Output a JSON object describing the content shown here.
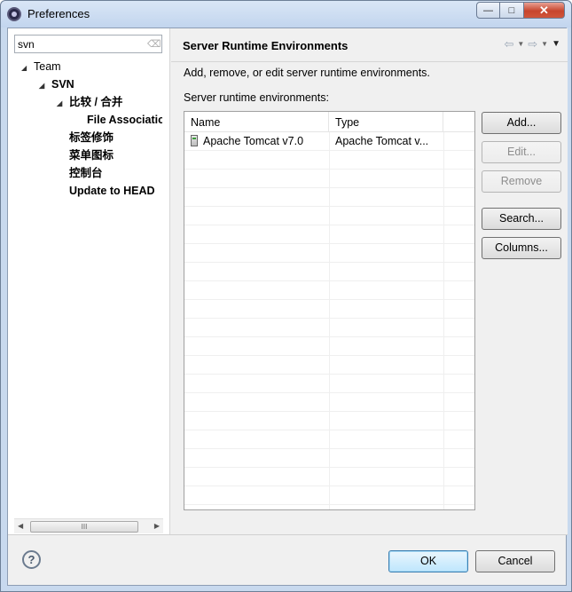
{
  "window": {
    "title": "Preferences",
    "min_glyph": "—",
    "max_glyph": "□",
    "close_glyph": "✕"
  },
  "sidebar": {
    "filter_value": "svn",
    "tree": [
      {
        "label": "Team",
        "twisty": "◢",
        "bold": false
      },
      {
        "label": "SVN",
        "twisty": "◢",
        "bold": true
      },
      {
        "label": "比较 / 合并",
        "twisty": "◢",
        "bold": true
      },
      {
        "label": "File Associatio",
        "twisty": "",
        "bold": true
      },
      {
        "label": "标签修饰",
        "twisty": "",
        "bold": true
      },
      {
        "label": "菜单图标",
        "twisty": "",
        "bold": true
      },
      {
        "label": "控制台",
        "twisty": "",
        "bold": true
      },
      {
        "label": "Update to HEAD",
        "twisty": "",
        "bold": true
      }
    ],
    "scroll_grip": "III"
  },
  "page": {
    "title": "Server Runtime Environments",
    "description": "Add, remove, or edit server runtime environments.",
    "table_label": "Server runtime environments:",
    "columns": [
      "Name",
      "Type"
    ],
    "rows": [
      {
        "name": "Apache Tomcat v7.0",
        "type": "Apache Tomcat v..."
      }
    ],
    "buttons": {
      "add": "Add...",
      "edit": "Edit...",
      "remove": "Remove",
      "search": "Search...",
      "columns": "Columns..."
    },
    "nav": {
      "back_glyph": "⇦",
      "forward_glyph": "⇨",
      "caret": "▼",
      "menu": "▼"
    }
  },
  "footer": {
    "help_glyph": "?",
    "ok": "OK",
    "cancel": "Cancel"
  }
}
